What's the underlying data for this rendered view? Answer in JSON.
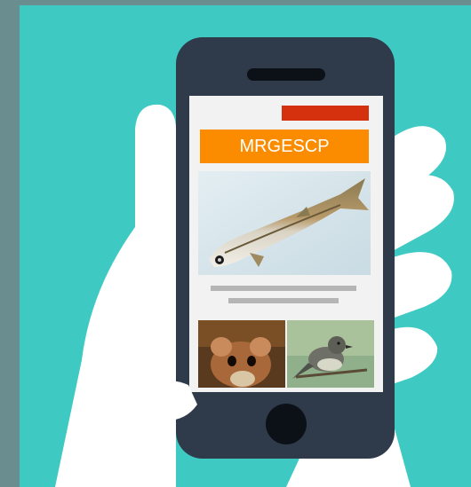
{
  "app": {
    "banner_title": "MRGESCP"
  },
  "colors": {
    "background_teal": "#3ec9c3",
    "phone_body": "#2f3a4a",
    "banner_orange": "#fb8c00",
    "accent_red": "#d6310f",
    "hand_white": "#ffffff"
  },
  "icons": [
    "hand-icon",
    "smartphone-icon",
    "fish-photo",
    "mouse-photo",
    "bird-photo",
    "home-button"
  ]
}
